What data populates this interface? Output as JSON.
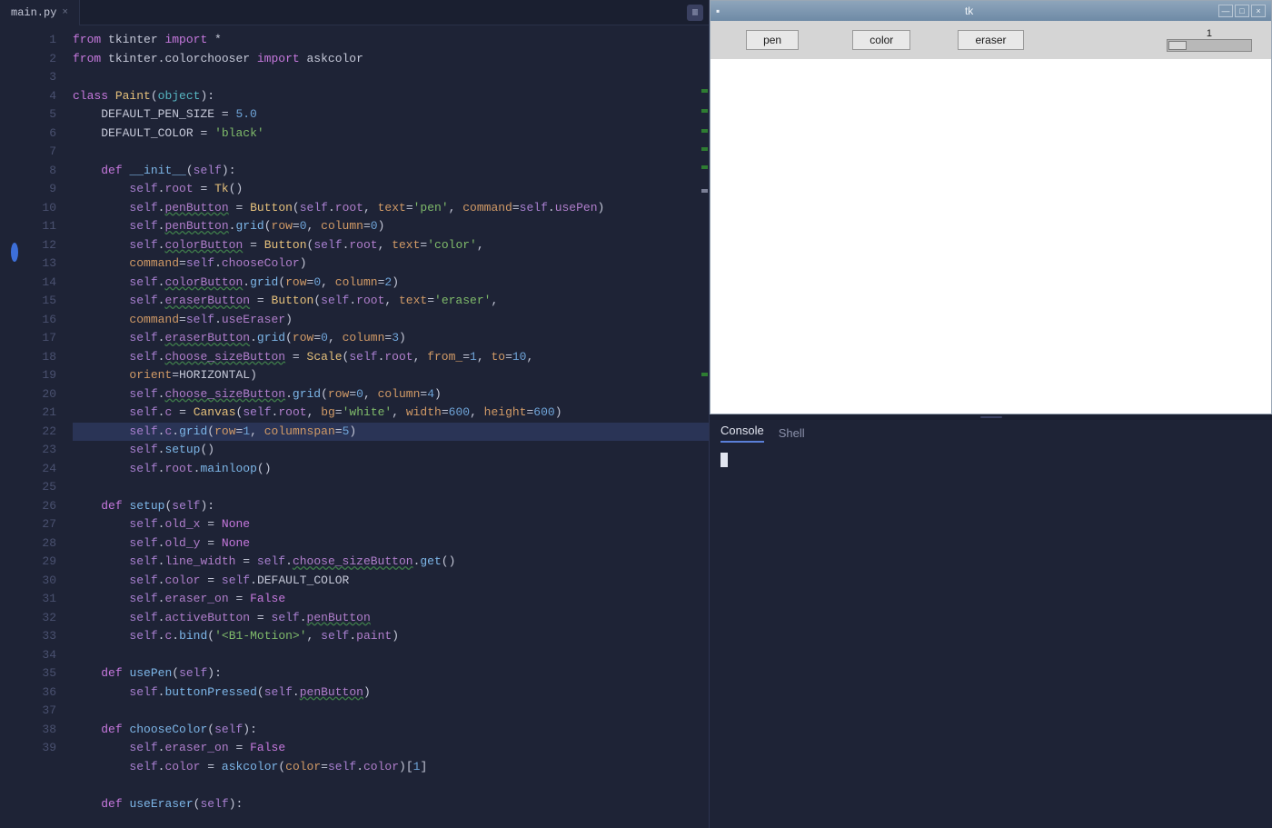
{
  "tab": {
    "filename": "main.py"
  },
  "gutter": {
    "start": 1,
    "end": 39,
    "active_line": 19,
    "breakpoint_line": 12
  },
  "code_lines": [
    [
      [
        "kw",
        "from"
      ],
      [
        "white",
        " tkinter "
      ],
      [
        "kw",
        "import"
      ],
      [
        "white",
        " *"
      ]
    ],
    [
      [
        "kw",
        "from"
      ],
      [
        "white",
        " tkinter"
      ],
      [
        "op",
        "."
      ],
      [
        "white",
        "colorchooser "
      ],
      [
        "kw",
        "import"
      ],
      [
        "white",
        " askcolor"
      ]
    ],
    [],
    [
      [
        "kw",
        "class"
      ],
      [
        "white",
        " "
      ],
      [
        "cls",
        "Paint"
      ],
      [
        "op",
        "("
      ],
      [
        "builtin",
        "object"
      ],
      [
        "op",
        ")"
      ],
      [
        "op",
        ":"
      ]
    ],
    [
      [
        "white",
        "    DEFAULT_PEN_SIZE "
      ],
      [
        "op",
        "="
      ],
      [
        "white",
        " "
      ],
      [
        "num",
        "5.0"
      ]
    ],
    [
      [
        "white",
        "    DEFAULT_COLOR "
      ],
      [
        "op",
        "="
      ],
      [
        "white",
        " "
      ],
      [
        "str",
        "'black'"
      ]
    ],
    [],
    [
      [
        "white",
        "    "
      ],
      [
        "kw",
        "def"
      ],
      [
        "white",
        " "
      ],
      [
        "fn",
        "__init__"
      ],
      [
        "op",
        "("
      ],
      [
        "self",
        "self"
      ],
      [
        "op",
        ")"
      ],
      [
        "op",
        ":"
      ]
    ],
    [
      [
        "white",
        "        "
      ],
      [
        "self",
        "self"
      ],
      [
        "op",
        "."
      ],
      [
        "ident",
        "root"
      ],
      [
        "white",
        " "
      ],
      [
        "op",
        "="
      ],
      [
        "white",
        " "
      ],
      [
        "cls",
        "Tk"
      ],
      [
        "op",
        "()"
      ]
    ],
    [
      [
        "white",
        "        "
      ],
      [
        "self",
        "self"
      ],
      [
        "op",
        "."
      ],
      [
        "ident",
        "penButton"
      ],
      [
        "white",
        " "
      ],
      [
        "op",
        "="
      ],
      [
        "white",
        " "
      ],
      [
        "cls",
        "Button"
      ],
      [
        "op",
        "("
      ],
      [
        "self",
        "self"
      ],
      [
        "op",
        "."
      ],
      [
        "ident",
        "root"
      ],
      [
        "op",
        ", "
      ],
      [
        "param",
        "text"
      ],
      [
        "op",
        "="
      ],
      [
        "str",
        "'pen'"
      ],
      [
        "op",
        ", "
      ],
      [
        "param",
        "command"
      ],
      [
        "op",
        "="
      ],
      [
        "self",
        "self"
      ],
      [
        "op",
        "."
      ],
      [
        "ident",
        "usePen"
      ],
      [
        "op",
        ")"
      ]
    ],
    [
      [
        "white",
        "        "
      ],
      [
        "self",
        "self"
      ],
      [
        "op",
        "."
      ],
      [
        "ident",
        "penButton"
      ],
      [
        "op",
        "."
      ],
      [
        "fn",
        "grid"
      ],
      [
        "op",
        "("
      ],
      [
        "param",
        "row"
      ],
      [
        "op",
        "="
      ],
      [
        "num",
        "0"
      ],
      [
        "op",
        ", "
      ],
      [
        "param",
        "column"
      ],
      [
        "op",
        "="
      ],
      [
        "num",
        "0"
      ],
      [
        "op",
        ")"
      ]
    ],
    [
      [
        "white",
        "        "
      ],
      [
        "self",
        "self"
      ],
      [
        "op",
        "."
      ],
      [
        "ident",
        "colorButton"
      ],
      [
        "white",
        " "
      ],
      [
        "op",
        "="
      ],
      [
        "white",
        " "
      ],
      [
        "cls",
        "Button"
      ],
      [
        "op",
        "("
      ],
      [
        "self",
        "self"
      ],
      [
        "op",
        "."
      ],
      [
        "ident",
        "root"
      ],
      [
        "op",
        ", "
      ],
      [
        "param",
        "text"
      ],
      [
        "op",
        "="
      ],
      [
        "str",
        "'color'"
      ],
      [
        "op",
        ", "
      ]
    ],
    [
      [
        "white",
        "        "
      ],
      [
        "param",
        "command"
      ],
      [
        "op",
        "="
      ],
      [
        "self",
        "self"
      ],
      [
        "op",
        "."
      ],
      [
        "ident",
        "chooseColor"
      ],
      [
        "op",
        ")"
      ]
    ],
    [
      [
        "white",
        "        "
      ],
      [
        "self",
        "self"
      ],
      [
        "op",
        "."
      ],
      [
        "ident",
        "colorButton"
      ],
      [
        "op",
        "."
      ],
      [
        "fn",
        "grid"
      ],
      [
        "op",
        "("
      ],
      [
        "param",
        "row"
      ],
      [
        "op",
        "="
      ],
      [
        "num",
        "0"
      ],
      [
        "op",
        ", "
      ],
      [
        "param",
        "column"
      ],
      [
        "op",
        "="
      ],
      [
        "num",
        "2"
      ],
      [
        "op",
        ")"
      ]
    ],
    [
      [
        "white",
        "        "
      ],
      [
        "self",
        "self"
      ],
      [
        "op",
        "."
      ],
      [
        "ident",
        "eraserButton"
      ],
      [
        "white",
        " "
      ],
      [
        "op",
        "="
      ],
      [
        "white",
        " "
      ],
      [
        "cls",
        "Button"
      ],
      [
        "op",
        "("
      ],
      [
        "self",
        "self"
      ],
      [
        "op",
        "."
      ],
      [
        "ident",
        "root"
      ],
      [
        "op",
        ", "
      ],
      [
        "param",
        "text"
      ],
      [
        "op",
        "="
      ],
      [
        "str",
        "'eraser'"
      ],
      [
        "op",
        ", "
      ]
    ],
    [
      [
        "white",
        "        "
      ],
      [
        "param",
        "command"
      ],
      [
        "op",
        "="
      ],
      [
        "self",
        "self"
      ],
      [
        "op",
        "."
      ],
      [
        "ident",
        "useEraser"
      ],
      [
        "op",
        ")"
      ]
    ],
    [
      [
        "white",
        "        "
      ],
      [
        "self",
        "self"
      ],
      [
        "op",
        "."
      ],
      [
        "ident",
        "eraserButton"
      ],
      [
        "op",
        "."
      ],
      [
        "fn",
        "grid"
      ],
      [
        "op",
        "("
      ],
      [
        "param",
        "row"
      ],
      [
        "op",
        "="
      ],
      [
        "num",
        "0"
      ],
      [
        "op",
        ", "
      ],
      [
        "param",
        "column"
      ],
      [
        "op",
        "="
      ],
      [
        "num",
        "3"
      ],
      [
        "op",
        ")"
      ]
    ],
    [
      [
        "white",
        "        "
      ],
      [
        "self",
        "self"
      ],
      [
        "op",
        "."
      ],
      [
        "ident",
        "choose_sizeButton"
      ],
      [
        "white",
        " "
      ],
      [
        "op",
        "="
      ],
      [
        "white",
        " "
      ],
      [
        "cls",
        "Scale"
      ],
      [
        "op",
        "("
      ],
      [
        "self",
        "self"
      ],
      [
        "op",
        "."
      ],
      [
        "ident",
        "root"
      ],
      [
        "op",
        ", "
      ],
      [
        "param",
        "from_"
      ],
      [
        "op",
        "="
      ],
      [
        "num",
        "1"
      ],
      [
        "op",
        ", "
      ],
      [
        "param",
        "to"
      ],
      [
        "op",
        "="
      ],
      [
        "num",
        "10"
      ],
      [
        "op",
        ", "
      ]
    ],
    [
      [
        "white",
        "        "
      ],
      [
        "param",
        "orient"
      ],
      [
        "op",
        "="
      ],
      [
        "white",
        "HORIZONTAL"
      ],
      [
        "op",
        ")"
      ]
    ],
    [
      [
        "white",
        "        "
      ],
      [
        "self",
        "self"
      ],
      [
        "op",
        "."
      ],
      [
        "ident",
        "choose_sizeButton"
      ],
      [
        "op",
        "."
      ],
      [
        "fn",
        "grid"
      ],
      [
        "op",
        "("
      ],
      [
        "param",
        "row"
      ],
      [
        "op",
        "="
      ],
      [
        "num",
        "0"
      ],
      [
        "op",
        ", "
      ],
      [
        "param",
        "column"
      ],
      [
        "op",
        "="
      ],
      [
        "num",
        "4"
      ],
      [
        "op",
        ")"
      ]
    ],
    [
      [
        "white",
        "        "
      ],
      [
        "self",
        "self"
      ],
      [
        "op",
        "."
      ],
      [
        "ident",
        "c"
      ],
      [
        "white",
        " "
      ],
      [
        "op",
        "="
      ],
      [
        "white",
        " "
      ],
      [
        "cls",
        "Canvas"
      ],
      [
        "op",
        "("
      ],
      [
        "self",
        "self"
      ],
      [
        "op",
        "."
      ],
      [
        "ident",
        "root"
      ],
      [
        "op",
        ", "
      ],
      [
        "param",
        "bg"
      ],
      [
        "op",
        "="
      ],
      [
        "str",
        "'white'"
      ],
      [
        "op",
        ", "
      ],
      [
        "param",
        "width"
      ],
      [
        "op",
        "="
      ],
      [
        "num",
        "600"
      ],
      [
        "op",
        ", "
      ],
      [
        "param",
        "height"
      ],
      [
        "op",
        "="
      ],
      [
        "num",
        "600"
      ],
      [
        "op",
        ")"
      ]
    ],
    [
      [
        "white",
        "        "
      ],
      [
        "self",
        "self"
      ],
      [
        "op",
        "."
      ],
      [
        "ident",
        "c"
      ],
      [
        "op",
        "."
      ],
      [
        "fn",
        "grid"
      ],
      [
        "op",
        "("
      ],
      [
        "param",
        "row"
      ],
      [
        "op",
        "="
      ],
      [
        "num",
        "1"
      ],
      [
        "op",
        ", "
      ],
      [
        "param",
        "columnspan"
      ],
      [
        "op",
        "="
      ],
      [
        "num",
        "5"
      ],
      [
        "op",
        ")"
      ]
    ],
    [
      [
        "white",
        "        "
      ],
      [
        "self",
        "self"
      ],
      [
        "op",
        "."
      ],
      [
        "fn",
        "setup"
      ],
      [
        "op",
        "()"
      ]
    ],
    [
      [
        "white",
        "        "
      ],
      [
        "self",
        "self"
      ],
      [
        "op",
        "."
      ],
      [
        "ident",
        "root"
      ],
      [
        "op",
        "."
      ],
      [
        "fn",
        "mainloop"
      ],
      [
        "op",
        "()"
      ]
    ],
    [],
    [
      [
        "white",
        "    "
      ],
      [
        "kw",
        "def"
      ],
      [
        "white",
        " "
      ],
      [
        "fn",
        "setup"
      ],
      [
        "op",
        "("
      ],
      [
        "self",
        "self"
      ],
      [
        "op",
        ")"
      ],
      [
        "op",
        ":"
      ]
    ],
    [
      [
        "white",
        "        "
      ],
      [
        "self",
        "self"
      ],
      [
        "op",
        "."
      ],
      [
        "ident",
        "old_x"
      ],
      [
        "white",
        " "
      ],
      [
        "op",
        "="
      ],
      [
        "white",
        " "
      ],
      [
        "kw",
        "None"
      ]
    ],
    [
      [
        "white",
        "        "
      ],
      [
        "self",
        "self"
      ],
      [
        "op",
        "."
      ],
      [
        "ident",
        "old_y"
      ],
      [
        "white",
        " "
      ],
      [
        "op",
        "="
      ],
      [
        "white",
        " "
      ],
      [
        "kw",
        "None"
      ]
    ],
    [
      [
        "white",
        "        "
      ],
      [
        "self",
        "self"
      ],
      [
        "op",
        "."
      ],
      [
        "ident",
        "line_width"
      ],
      [
        "white",
        " "
      ],
      [
        "op",
        "="
      ],
      [
        "white",
        " "
      ],
      [
        "self",
        "self"
      ],
      [
        "op",
        "."
      ],
      [
        "ident",
        "choose_sizeButton"
      ],
      [
        "op",
        "."
      ],
      [
        "fn",
        "get"
      ],
      [
        "op",
        "()"
      ]
    ],
    [
      [
        "white",
        "        "
      ],
      [
        "self",
        "self"
      ],
      [
        "op",
        "."
      ],
      [
        "ident",
        "color"
      ],
      [
        "white",
        " "
      ],
      [
        "op",
        "="
      ],
      [
        "white",
        " "
      ],
      [
        "self",
        "self"
      ],
      [
        "op",
        "."
      ],
      [
        "white",
        "DEFAULT_COLOR"
      ]
    ],
    [
      [
        "white",
        "        "
      ],
      [
        "self",
        "self"
      ],
      [
        "op",
        "."
      ],
      [
        "ident",
        "eraser_on"
      ],
      [
        "white",
        " "
      ],
      [
        "op",
        "="
      ],
      [
        "white",
        " "
      ],
      [
        "kw",
        "False"
      ]
    ],
    [
      [
        "white",
        "        "
      ],
      [
        "self",
        "self"
      ],
      [
        "op",
        "."
      ],
      [
        "ident",
        "activeButton"
      ],
      [
        "white",
        " "
      ],
      [
        "op",
        "="
      ],
      [
        "white",
        " "
      ],
      [
        "self",
        "self"
      ],
      [
        "op",
        "."
      ],
      [
        "ident",
        "penButton"
      ]
    ],
    [
      [
        "white",
        "        "
      ],
      [
        "self",
        "self"
      ],
      [
        "op",
        "."
      ],
      [
        "ident",
        "c"
      ],
      [
        "op",
        "."
      ],
      [
        "fn",
        "bind"
      ],
      [
        "op",
        "("
      ],
      [
        "str",
        "'<B1-Motion>'"
      ],
      [
        "op",
        ", "
      ],
      [
        "self",
        "self"
      ],
      [
        "op",
        "."
      ],
      [
        "ident",
        "paint"
      ],
      [
        "op",
        ")"
      ]
    ],
    [],
    [
      [
        "white",
        "    "
      ],
      [
        "kw",
        "def"
      ],
      [
        "white",
        " "
      ],
      [
        "fn",
        "usePen"
      ],
      [
        "op",
        "("
      ],
      [
        "self",
        "self"
      ],
      [
        "op",
        ")"
      ],
      [
        "op",
        ":"
      ]
    ],
    [
      [
        "white",
        "        "
      ],
      [
        "self",
        "self"
      ],
      [
        "op",
        "."
      ],
      [
        "fn",
        "buttonPressed"
      ],
      [
        "op",
        "("
      ],
      [
        "self",
        "self"
      ],
      [
        "op",
        "."
      ],
      [
        "ident",
        "penButton"
      ],
      [
        "op",
        ")"
      ]
    ],
    [],
    [
      [
        "white",
        "    "
      ],
      [
        "kw",
        "def"
      ],
      [
        "white",
        " "
      ],
      [
        "fn",
        "chooseColor"
      ],
      [
        "op",
        "("
      ],
      [
        "self",
        "self"
      ],
      [
        "op",
        ")"
      ],
      [
        "op",
        ":"
      ]
    ],
    [
      [
        "white",
        "        "
      ],
      [
        "self",
        "self"
      ],
      [
        "op",
        "."
      ],
      [
        "ident",
        "eraser_on"
      ],
      [
        "white",
        " "
      ],
      [
        "op",
        "="
      ],
      [
        "white",
        " "
      ],
      [
        "kw",
        "False"
      ]
    ],
    [
      [
        "white",
        "        "
      ],
      [
        "self",
        "self"
      ],
      [
        "op",
        "."
      ],
      [
        "ident",
        "color"
      ],
      [
        "white",
        " "
      ],
      [
        "op",
        "="
      ],
      [
        "white",
        " "
      ],
      [
        "fn",
        "askcolor"
      ],
      [
        "op",
        "("
      ],
      [
        "param",
        "color"
      ],
      [
        "op",
        "="
      ],
      [
        "self",
        "self"
      ],
      [
        "op",
        "."
      ],
      [
        "ident",
        "color"
      ],
      [
        "op",
        ")["
      ],
      [
        "num",
        "1"
      ],
      [
        "op",
        "]"
      ]
    ],
    [],
    [
      [
        "white",
        "    "
      ],
      [
        "kw",
        "def"
      ],
      [
        "white",
        " "
      ],
      [
        "fn",
        "useEraser"
      ],
      [
        "op",
        "("
      ],
      [
        "self",
        "self"
      ],
      [
        "op",
        ")"
      ],
      [
        "op",
        ":"
      ]
    ]
  ],
  "tk": {
    "title": "tk",
    "buttons": {
      "pen": "pen",
      "color": "color",
      "eraser": "eraser"
    },
    "scale_value": "1"
  },
  "console": {
    "tabs": {
      "console": "Console",
      "shell": "Shell"
    }
  }
}
